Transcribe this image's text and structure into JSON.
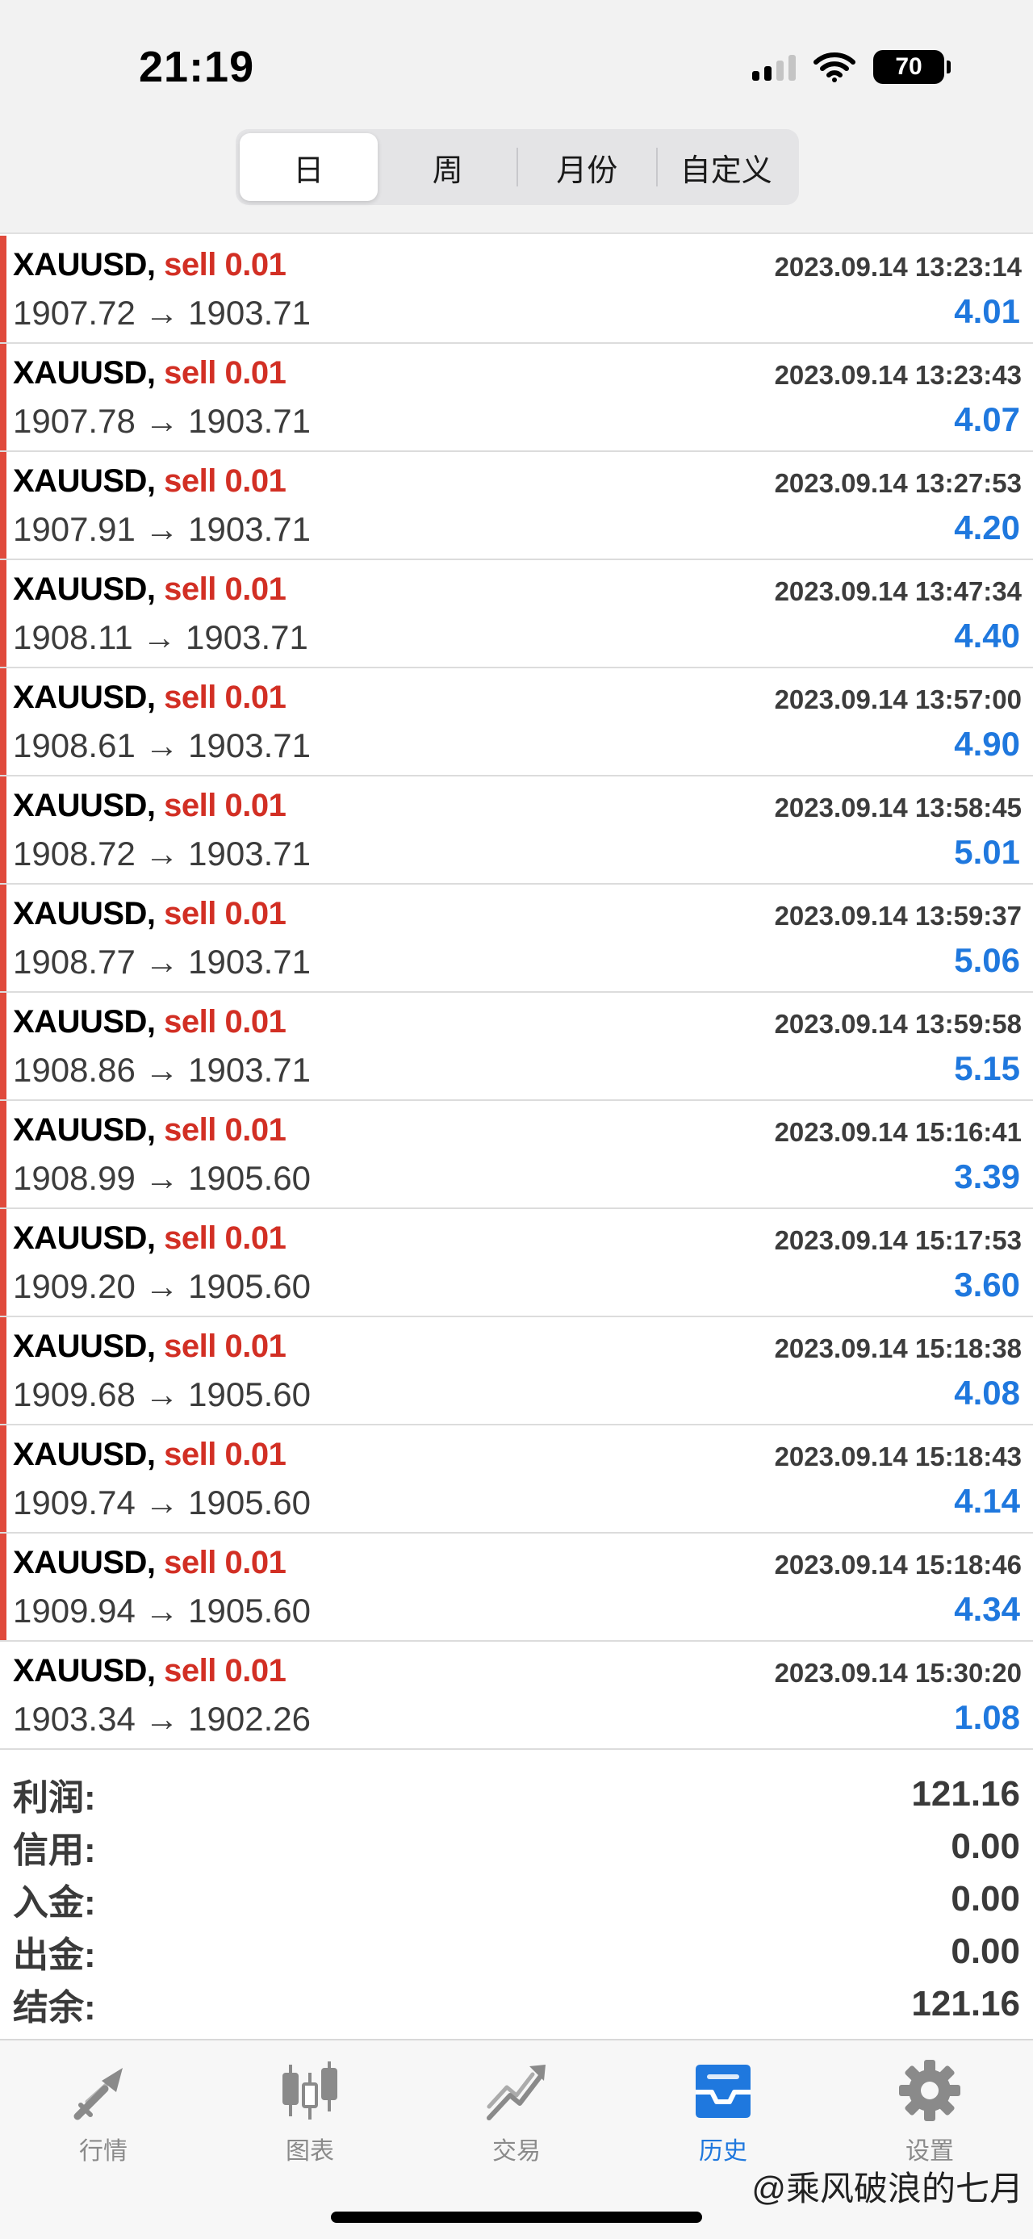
{
  "status_bar": {
    "time": "21:19",
    "battery": "70"
  },
  "period_tabs": [
    {
      "label": "日",
      "active": true
    },
    {
      "label": "周",
      "active": false
    },
    {
      "label": "月份",
      "active": false
    },
    {
      "label": "自定义",
      "active": false
    }
  ],
  "deals": [
    {
      "symbol": "XAUUSD,",
      "side": "sell 0.01",
      "time": "2023.09.14 13:23:14",
      "prices": "1907.72 → 1903.71",
      "profit": "4.01"
    },
    {
      "symbol": "XAUUSD,",
      "side": "sell 0.01",
      "time": "2023.09.14 13:23:43",
      "prices": "1907.78 → 1903.71",
      "profit": "4.07"
    },
    {
      "symbol": "XAUUSD,",
      "side": "sell 0.01",
      "time": "2023.09.14 13:27:53",
      "prices": "1907.91 → 1903.71",
      "profit": "4.20"
    },
    {
      "symbol": "XAUUSD,",
      "side": "sell 0.01",
      "time": "2023.09.14 13:47:34",
      "prices": "1908.11 → 1903.71",
      "profit": "4.40"
    },
    {
      "symbol": "XAUUSD,",
      "side": "sell 0.01",
      "time": "2023.09.14 13:57:00",
      "prices": "1908.61 → 1903.71",
      "profit": "4.90"
    },
    {
      "symbol": "XAUUSD,",
      "side": "sell 0.01",
      "time": "2023.09.14 13:58:45",
      "prices": "1908.72 → 1903.71",
      "profit": "5.01"
    },
    {
      "symbol": "XAUUSD,",
      "side": "sell 0.01",
      "time": "2023.09.14 13:59:37",
      "prices": "1908.77 → 1903.71",
      "profit": "5.06"
    },
    {
      "symbol": "XAUUSD,",
      "side": "sell 0.01",
      "time": "2023.09.14 13:59:58",
      "prices": "1908.86 → 1903.71",
      "profit": "5.15"
    },
    {
      "symbol": "XAUUSD,",
      "side": "sell 0.01",
      "time": "2023.09.14 15:16:41",
      "prices": "1908.99 → 1905.60",
      "profit": "3.39"
    },
    {
      "symbol": "XAUUSD,",
      "side": "sell 0.01",
      "time": "2023.09.14 15:17:53",
      "prices": "1909.20 → 1905.60",
      "profit": "3.60"
    },
    {
      "symbol": "XAUUSD,",
      "side": "sell 0.01",
      "time": "2023.09.14 15:18:38",
      "prices": "1909.68 → 1905.60",
      "profit": "4.08"
    },
    {
      "symbol": "XAUUSD,",
      "side": "sell 0.01",
      "time": "2023.09.14 15:18:43",
      "prices": "1909.74 → 1905.60",
      "profit": "4.14"
    },
    {
      "symbol": "XAUUSD,",
      "side": "sell 0.01",
      "time": "2023.09.14 15:18:46",
      "prices": "1909.94 → 1905.60",
      "profit": "4.34"
    },
    {
      "symbol": "XAUUSD,",
      "side": "sell 0.01",
      "time": "2023.09.14 15:30:20",
      "prices": "1903.34 → 1902.26",
      "profit": "1.08"
    }
  ],
  "summary": [
    {
      "label": "利润:",
      "value": "121.16"
    },
    {
      "label": "信用:",
      "value": "0.00"
    },
    {
      "label": "入金:",
      "value": "0.00"
    },
    {
      "label": "出金:",
      "value": "0.00"
    },
    {
      "label": "结余:",
      "value": "121.16"
    }
  ],
  "tab_bar": [
    {
      "label": "行情",
      "icon": "quotes-arrows-icon",
      "active": false
    },
    {
      "label": "图表",
      "icon": "candlestick-chart-icon",
      "active": false
    },
    {
      "label": "交易",
      "icon": "trade-trend-icon",
      "active": false
    },
    {
      "label": "历史",
      "icon": "history-inbox-icon",
      "active": true
    },
    {
      "label": "设置",
      "icon": "gear-icon",
      "active": false
    }
  ],
  "watermark": "@乘风破浪的七月",
  "colors": {
    "sell": "#d22f24",
    "profit": "#1f78de",
    "row_marker": "#e04a3c",
    "tab_active": "#1f78de",
    "tab_inactive": "#8a8a8a"
  }
}
